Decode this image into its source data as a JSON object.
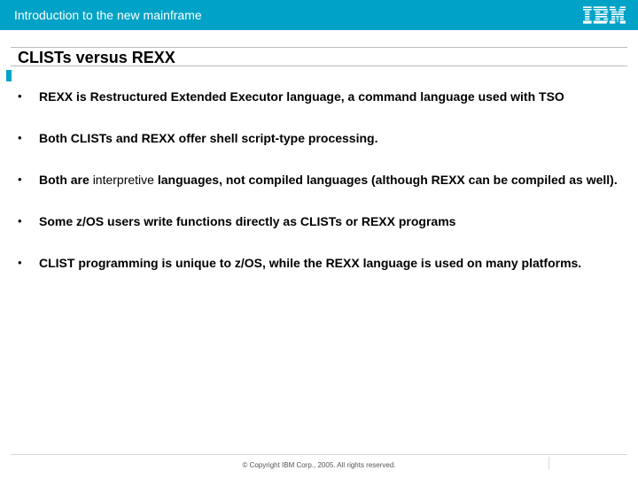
{
  "header": {
    "subtitle": "Introduction to the new mainframe",
    "logo_alt": "IBM"
  },
  "title": "CLISTs versus REXX",
  "bullets": [
    {
      "text": "REXX is Restructured Extended Executor language, a command language used with TSO"
    },
    {
      "text": "Both CLISTs and REXX offer shell script-type processing."
    },
    {
      "text_pre": "Both are ",
      "text_mid_nb": "interpretive",
      "text_post": " languages, not compiled languages (although REXX can be compiled as well)."
    },
    {
      "text": "Some z/OS users write functions directly as CLISTs or REXX programs"
    },
    {
      "text": "CLIST programming is unique to z/OS, while the REXX language is used on many platforms."
    }
  ],
  "footer": {
    "copyright": "© Copyright IBM Corp., 2005. All rights reserved."
  }
}
